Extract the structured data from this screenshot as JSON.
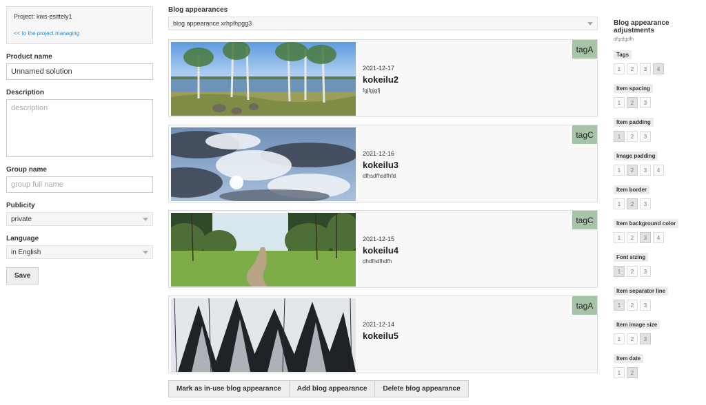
{
  "left": {
    "project_label": "Project: kws-esittely1",
    "project_link": "<< to the project managing",
    "product_name_label": "Product name",
    "product_name_value": "Unnamed solution",
    "description_label": "Description",
    "description_placeholder": "description",
    "group_name_label": "Group name",
    "group_name_placeholder": "group full name",
    "publicity_label": "Publicity",
    "publicity_value": "private",
    "language_label": "Language",
    "language_value": "in English",
    "save_label": "Save"
  },
  "mid": {
    "title": "Blog appearances",
    "selected_appearance": "blog appearance xrhplhpgg3",
    "cards": [
      {
        "date": "2021-12-17",
        "title": "kokeilu2",
        "desc": "fgjfgjgfj",
        "tag": "tagA"
      },
      {
        "date": "2021-12-16",
        "title": "kokeilu3",
        "desc": "dfhsdfhsdfhfd",
        "tag": "tagC"
      },
      {
        "date": "2021-12-15",
        "title": "kokeilu4",
        "desc": "dhdfhdfhdfh",
        "tag": "tagC"
      },
      {
        "date": "2021-12-14",
        "title": "kokeilu5",
        "desc": "",
        "tag": "tagA"
      }
    ],
    "buttons": {
      "mark": "Mark as in-use blog appearance",
      "add": "Add blog appearance",
      "delete": "Delete blog appearance"
    }
  },
  "right": {
    "title": "Blog appearance adjustments",
    "subtitle": "dfgdfgdfh",
    "groups": [
      {
        "label": "Tags",
        "options": [
          "1",
          "2",
          "3",
          "4"
        ],
        "selected": 4
      },
      {
        "label": "Item spacing",
        "options": [
          "1",
          "2",
          "3"
        ],
        "selected": 2
      },
      {
        "label": "Item padding",
        "options": [
          "1",
          "2",
          "3"
        ],
        "selected": 1
      },
      {
        "label": "Image padding",
        "options": [
          "1",
          "2",
          "3",
          "4"
        ],
        "selected": 2
      },
      {
        "label": "Item border",
        "options": [
          "1",
          "2",
          "3"
        ],
        "selected": 2
      },
      {
        "label": "Item background color",
        "options": [
          "1",
          "2",
          "3",
          "4"
        ],
        "selected": 3
      },
      {
        "label": "Font sizing",
        "options": [
          "1",
          "2",
          "3"
        ],
        "selected": 1
      },
      {
        "label": "Item separator line",
        "options": [
          "1",
          "2",
          "3"
        ],
        "selected": 1
      },
      {
        "label": "Item image size",
        "options": [
          "1",
          "2",
          "3"
        ],
        "selected": 3
      },
      {
        "label": "Item date",
        "options": [
          "1",
          "2"
        ],
        "selected": 2
      }
    ]
  },
  "colors": {
    "tag_bg": "#a8c4a8",
    "link": "#2a8fd0",
    "panel_bg": "#f6f6f6"
  }
}
